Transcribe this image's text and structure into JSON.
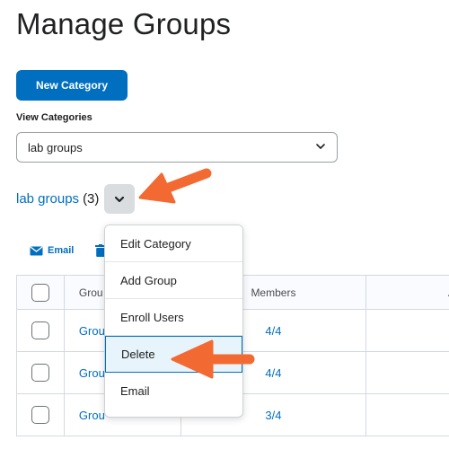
{
  "page": {
    "title": "Manage Groups"
  },
  "actions": {
    "new_category": "New Category"
  },
  "view_categories": {
    "label": "View Categories",
    "selected": "lab groups"
  },
  "category": {
    "name": "lab groups",
    "count": "(3)"
  },
  "toolbar": {
    "email": "Email"
  },
  "table": {
    "headers": [
      "Grou",
      "Members",
      "A"
    ],
    "rows": [
      {
        "group": "Grou",
        "members": "4/4"
      },
      {
        "group": "Grou",
        "members": "4/4"
      },
      {
        "group": "Grou",
        "members": "3/4"
      }
    ]
  },
  "menu": {
    "items": [
      "Edit Category",
      "Add Group",
      "Enroll Users",
      "Delete",
      "Email"
    ],
    "active_item": "Delete"
  },
  "colors": {
    "accent": "#006fbf",
    "arrow": "#f26a31"
  },
  "icons": [
    "chevron-down-icon",
    "email-icon",
    "trash-icon",
    "pointer-arrow"
  ]
}
